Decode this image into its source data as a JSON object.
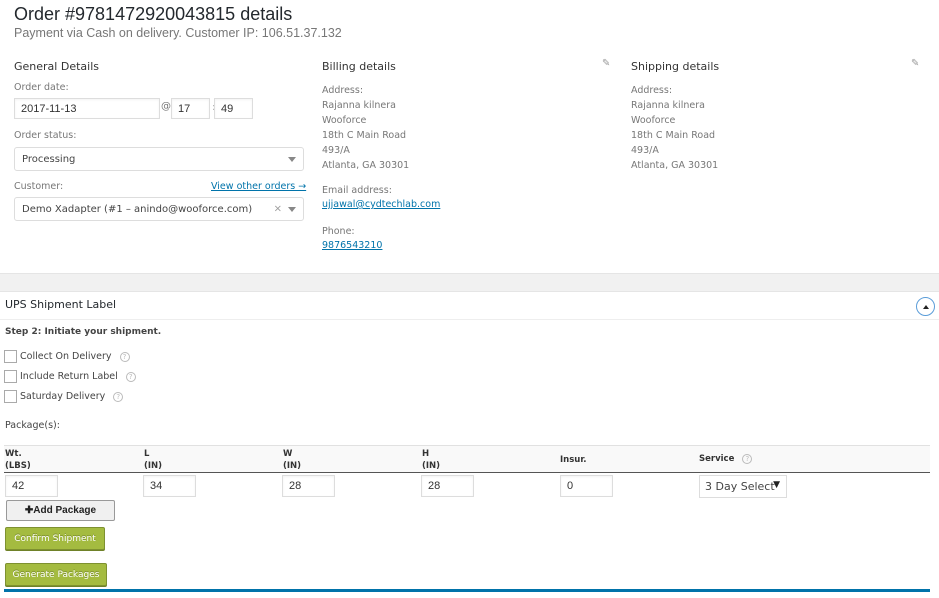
{
  "header": {
    "title": "Order #9781472920043815 details",
    "subtitle": "Payment via Cash on delivery. Customer IP: 106.51.37.132"
  },
  "general": {
    "heading": "General Details",
    "order_date_label": "Order date:",
    "order_date": "2017-11-13",
    "at_symbol": "@",
    "hour": "17",
    "time_sep": ":",
    "minute": "49",
    "status_label": "Order status:",
    "status_value": "Processing",
    "customer_label": "Customer:",
    "view_other_orders": "View other orders →",
    "customer_value": "Demo Xadapter (#1 – anindo@wooforce.com)",
    "clear_symbol": "×"
  },
  "billing": {
    "heading": "Billing details",
    "address_label": "Address:",
    "address_lines": [
      "Rajanna kilnera",
      "Wooforce",
      "18th C Main Road",
      "493/A",
      "Atlanta, GA 30301"
    ],
    "email_label": "Email address:",
    "email": "ujjawal@cydtechlab.com",
    "phone_label": "Phone:",
    "phone": "9876543210"
  },
  "shipping": {
    "heading": "Shipping details",
    "address_label": "Address:",
    "address_lines": [
      "Rajanna kilnera",
      "Wooforce",
      "18th C Main Road",
      "493/A",
      "Atlanta, GA 30301"
    ]
  },
  "ups": {
    "panel_title": "UPS Shipment Label",
    "step_label": "Step 2: Initiate your shipment.",
    "options": [
      {
        "label": "Collect On Delivery",
        "checked": false
      },
      {
        "label": "Include Return Label",
        "checked": false
      },
      {
        "label": "Saturday Delivery",
        "checked": false
      }
    ],
    "help_glyph": "?",
    "packages_label": "Package(s):",
    "columns": [
      {
        "line1": "Wt.",
        "line2": "(LBS)"
      },
      {
        "line1": "L",
        "line2": "(IN)"
      },
      {
        "line1": "W",
        "line2": "(IN)"
      },
      {
        "line1": "H",
        "line2": "(IN)"
      },
      {
        "line1": "Insur.",
        "line2": ""
      },
      {
        "line1": "Service",
        "line2": ""
      }
    ],
    "package": {
      "weight": "42",
      "length": "34",
      "width": "28",
      "height": "28",
      "insurance": "0",
      "service": "3 Day Select"
    },
    "add_package_button": "✚Add Package",
    "confirm_button": "Confirm Shipment",
    "generate_button": "Generate Packages"
  },
  "colors": {
    "link": "#0073aa",
    "green_button": "#a4bb40",
    "accent_bar": "#0073aa"
  }
}
